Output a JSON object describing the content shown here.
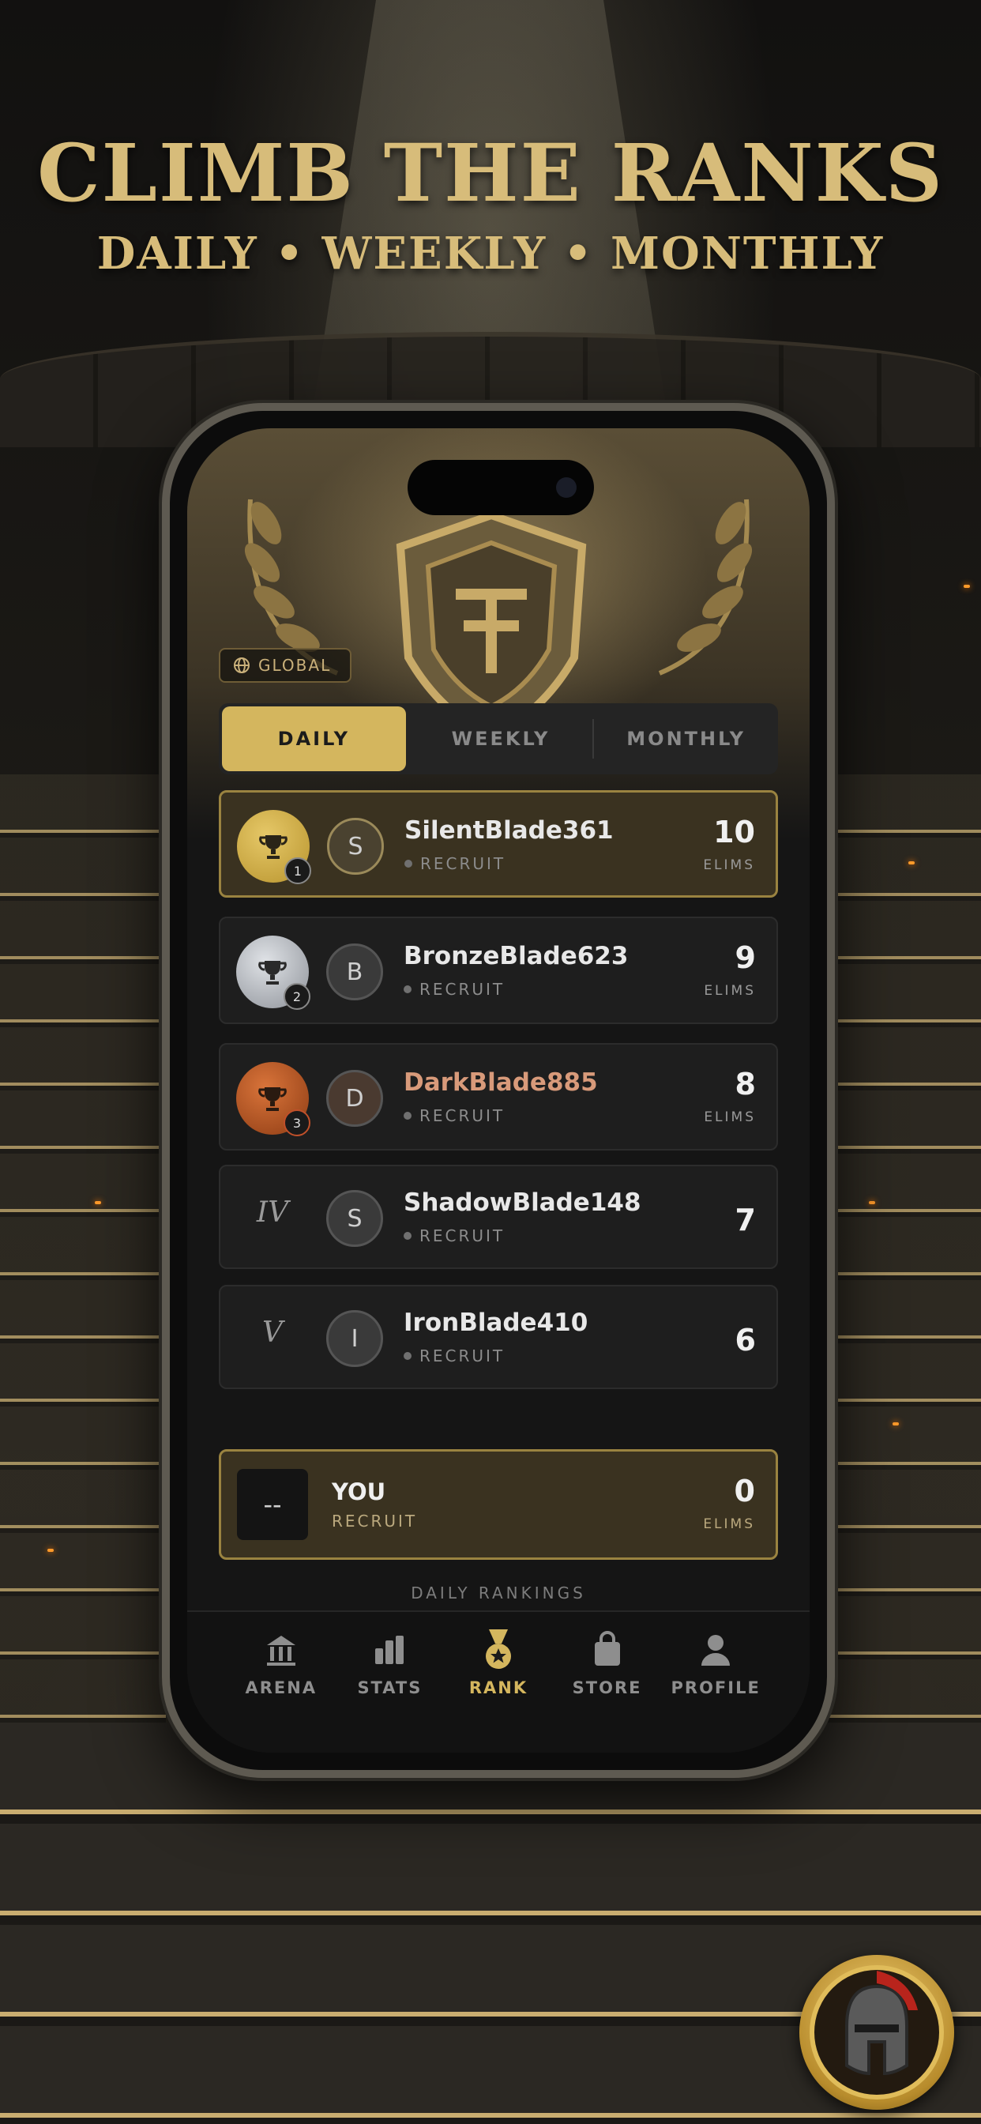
{
  "promo": {
    "headline": "CLIMB THE RANKS",
    "subline": "DAILY • WEEKLY • MONTHLY"
  },
  "app": {
    "scope_badge": "GLOBAL",
    "tabs": [
      {
        "label": "DAILY",
        "active": true
      },
      {
        "label": "WEEKLY",
        "active": false
      },
      {
        "label": "MONTHLY",
        "active": false
      }
    ],
    "unit_label": "ELIMS",
    "leaderboard": [
      {
        "rank": "1",
        "initial": "S",
        "name": "SilentBlade361",
        "title": "RECRUIT",
        "score": "10",
        "medal": "gold"
      },
      {
        "rank": "2",
        "initial": "B",
        "name": "BronzeBlade623",
        "title": "RECRUIT",
        "score": "9",
        "medal": "silver"
      },
      {
        "rank": "3",
        "initial": "D",
        "name": "DarkBlade885",
        "title": "RECRUIT",
        "score": "8",
        "medal": "bronze"
      },
      {
        "rank": "IV",
        "initial": "S",
        "name": "ShadowBlade148",
        "title": "RECRUIT",
        "score": "7"
      },
      {
        "rank": "V",
        "initial": "I",
        "name": "IronBlade410",
        "title": "RECRUIT",
        "score": "6"
      }
    ],
    "you": {
      "placeholder": "--",
      "name": "YOU",
      "title": "RECRUIT",
      "score": "0"
    },
    "footer_caption": "DAILY RANKINGS",
    "nav": [
      {
        "label": "ARENA",
        "icon": "arena-icon"
      },
      {
        "label": "STATS",
        "icon": "stats-icon"
      },
      {
        "label": "RANK",
        "icon": "medal-icon",
        "active": true
      },
      {
        "label": "STORE",
        "icon": "bag-icon"
      },
      {
        "label": "PROFILE",
        "icon": "profile-icon"
      }
    ]
  },
  "colors": {
    "gold": "#d4b65e",
    "silver": "#b9bcc2",
    "bronze": "#b85a22",
    "bronze_name": "#d89a7a"
  }
}
